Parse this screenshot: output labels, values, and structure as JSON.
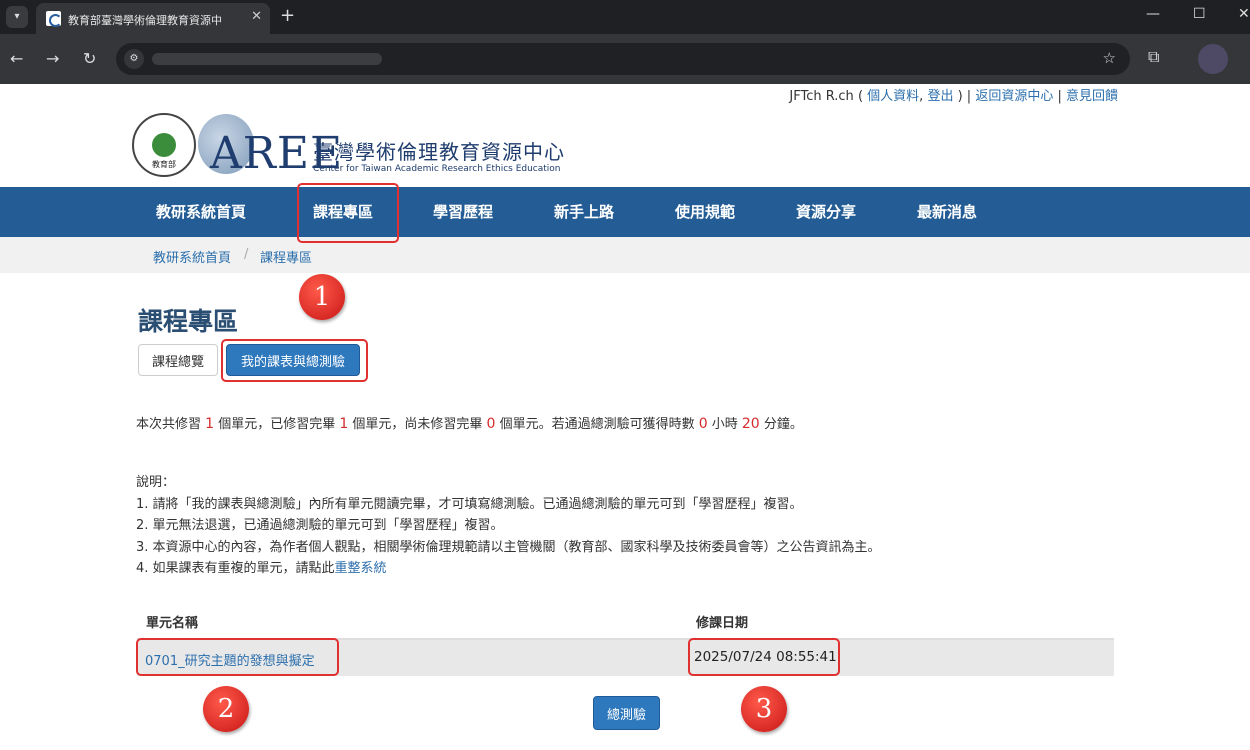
{
  "browser": {
    "tab_title": "教育部臺灣學術倫理教育資源中",
    "new_tab": "+",
    "close": "✕",
    "minimize": "—",
    "maximize": "☐",
    "close_window": "✕",
    "back": "←",
    "forward": "→",
    "reload": "↻",
    "star": "☆",
    "extensions": "⧉",
    "site_info": "⚙"
  },
  "header": {
    "user": "JFTch R.ch",
    "open_paren": " ( ",
    "profile_link": "個人資料",
    "comma": ", ",
    "logout_link": "登出",
    "close_paren": " ) | ",
    "back_link": "返回資源中心",
    "pipe": " | ",
    "feedback_link": "意見回饋",
    "moe_logo_text": "教育部",
    "aree_mark": "AREE",
    "site_title": "臺灣學術倫理教育資源中心",
    "site_subtitle": "Center for Taiwan Academic Research Ethics Education"
  },
  "nav": {
    "items": [
      "教研系統首頁",
      "課程專區",
      "學習歷程",
      "新手上路",
      "使用規範",
      "資源分享",
      "最新消息"
    ]
  },
  "breadcrumb": {
    "home": "教研系統首頁",
    "separator": "/",
    "current": "課程專區"
  },
  "main": {
    "heading": "課程專區",
    "tab_overview": "課程總覽",
    "tab_my": "我的課表與總測驗",
    "summary": {
      "p1": "本次共修習 ",
      "total": "1",
      "p2": " 個單元，已修習完畢 ",
      "completed": "1",
      "p3": " 個單元，尚未修習完畢 ",
      "remaining": "0",
      "p4": " 個單元。若通過總測驗可獲得時數 ",
      "hours": "0",
      "p5": " 小時 ",
      "minutes": "20",
      "p6": " 分鐘。"
    },
    "notes": {
      "title": "說明：",
      "line1": "1. 請將「我的課表與總測驗」內所有單元閱讀完畢，才可填寫總測驗。已通過總測驗的單元可到「學習歷程」複習。",
      "line2": "2. 單元無法退選，已通過總測驗的單元可到「學習歷程」複習。",
      "line3": "3. 本資源中心的內容，為作者個人觀點，相關學術倫理規範請以主管機關（教育部、國家科學及技術委員會等）之公告資訊為主。",
      "line4_prefix": "4. 如果課表有重複的單元，請點此",
      "line4_link": "重整系統"
    },
    "table": {
      "col_name": "單元名稱",
      "col_date": "修課日期",
      "rows": [
        {
          "name": "0701_研究主題的發想與擬定",
          "date": "2025/07/24 08:55:41"
        }
      ]
    },
    "test_button": "總測驗"
  },
  "annotations": {
    "markers": [
      "1",
      "2",
      "3"
    ],
    "color": "#e03030"
  }
}
